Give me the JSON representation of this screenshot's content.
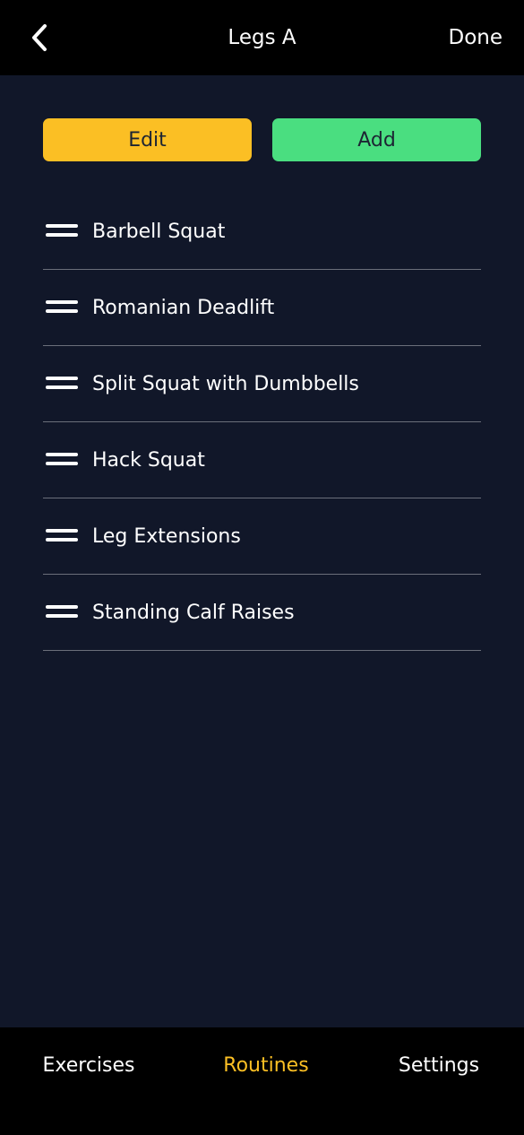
{
  "header": {
    "back_icon": "chevron-left-icon",
    "title": "Legs A",
    "done_label": "Done"
  },
  "actions": {
    "edit_label": "Edit",
    "edit_color": "#fbbf24",
    "add_label": "Add",
    "add_color": "#4ade80"
  },
  "exercises": [
    {
      "name": "Barbell Squat"
    },
    {
      "name": "Romanian Deadlift"
    },
    {
      "name": "Split Squat with Dumbbells"
    },
    {
      "name": "Hack Squat"
    },
    {
      "name": "Leg Extensions"
    },
    {
      "name": "Standing Calf Raises"
    }
  ],
  "tabbar": {
    "tabs": [
      {
        "label": "Exercises",
        "active": false
      },
      {
        "label": "Routines",
        "active": true
      },
      {
        "label": "Settings",
        "active": false
      }
    ],
    "active_color": "#fbbf24"
  },
  "colors": {
    "background": "#111729",
    "bar_background": "#000000"
  }
}
